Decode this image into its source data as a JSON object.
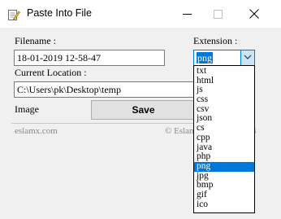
{
  "window": {
    "title": "Paste Into File"
  },
  "form": {
    "filename_label": "Filename :",
    "filename_value": "18-01-2019 12-58-47",
    "extension_label": "Extension :",
    "location_label": "Current Location :",
    "location_value": "C:\\Users\\pk\\Desktop\\temp",
    "image_label": "Image",
    "save_label": "Save"
  },
  "footer": {
    "left_text": "eslamx.com",
    "right_text": "© Eslam",
    "right_tail": "4"
  },
  "extension_combo": {
    "selected": "png",
    "options": [
      "txt",
      "html",
      "js",
      "css",
      "csv",
      "json",
      "cs",
      "cpp",
      "java",
      "php",
      "png",
      "jpg",
      "bmp",
      "gif",
      "ico"
    ],
    "selected_index": 10
  },
  "colors": {
    "accent": "#0078d7",
    "window_bg": "#f0f0f0",
    "titlebar_bg": "#ffffff"
  },
  "icons": {
    "app": "edit-document-icon",
    "minimize": "minimize-icon",
    "maximize": "maximize-icon",
    "close": "close-icon",
    "dropdown": "chevron-down-icon"
  }
}
